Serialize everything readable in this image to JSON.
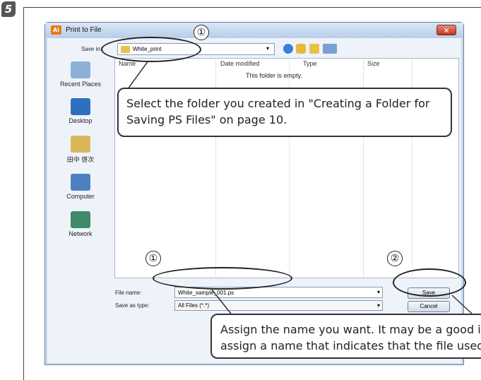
{
  "step_number": "5",
  "dialog": {
    "title": "Print to File",
    "app_icon_text": "Ai",
    "close_symbol": "✕",
    "save_in_label": "Save in:",
    "save_in_value": "White_print",
    "places": [
      "Recent Places",
      "Desktop",
      "田中 啓次",
      "Computer",
      "Network"
    ],
    "columns": [
      "Name",
      "Date modified",
      "Type",
      "Size"
    ],
    "empty_message": "This folder is empty.",
    "file_name_label": "File name:",
    "file_name_value": "White_sample_001.ps",
    "save_as_type_label": "Save as type:",
    "save_as_type_value": "All Files (*.*)",
    "save_button": "Save",
    "cancel_button": "Cancel",
    "dropdown_glyph": "▾"
  },
  "callouts": {
    "folder_note": "Select the folder you created in \"Creating a Folder for Saving PS Files\" on page 10.",
    "name_note": "Assign the name you want. It may be a good idea to assign a name that indicates that the file used"
  },
  "markers": {
    "one": "①",
    "one_b": "①",
    "two": "②"
  },
  "colors": {
    "accent": "#e87a1b",
    "close": "#c2331c"
  }
}
